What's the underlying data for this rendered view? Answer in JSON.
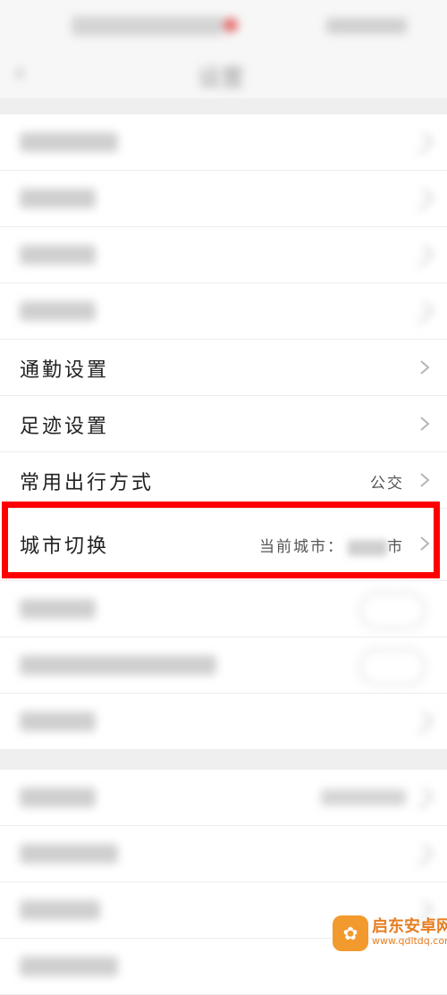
{
  "nav": {
    "title": "设置"
  },
  "rows": {
    "commute": {
      "label": "通勤设置"
    },
    "footprint": {
      "label": "足迹设置"
    },
    "travel_mode": {
      "label": "常用出行方式",
      "value": "公交"
    },
    "city_switch": {
      "label": "城市切换",
      "value_prefix": "当前城市：",
      "value_suffix": "市"
    }
  },
  "watermark": {
    "name": "启东安卓网",
    "url": "www.qdltdq.com",
    "logo_glyph": "✿"
  },
  "colors": {
    "highlight": "#ff0000",
    "background": "#f2f2f2",
    "row_bg": "#ffffff"
  }
}
